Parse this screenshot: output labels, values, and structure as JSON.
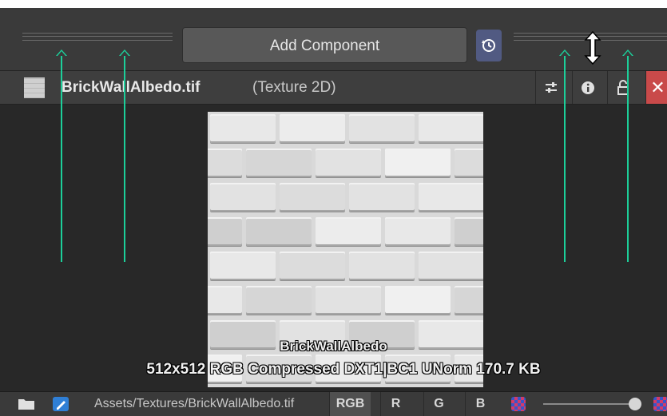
{
  "toolbar": {
    "add_component_label": "Add Component",
    "history_icon": "history-icon"
  },
  "header": {
    "asset_name": "BrickWallAlbedo.tif",
    "asset_type": "(Texture 2D)",
    "buttons": [
      "settings-sliders-icon",
      "info-icon",
      "lock-icon",
      "close-icon"
    ]
  },
  "preview": {
    "name": "BrickWallAlbedo",
    "description": "512x512  RGB Compressed DXT1|BC1 UNorm   170.7 KB"
  },
  "bottombar": {
    "path": "Assets/Textures/BrickWallAlbedo.tif",
    "channels": [
      "RGB",
      "R",
      "G",
      "B"
    ],
    "active_channel": "RGB"
  },
  "colors": {
    "panel_bg": "#282828",
    "toolbar_bg": "#3a3a3a",
    "history_button": "#515a82",
    "close_button": "#c94a4a",
    "annotation_arrow": "#1ccf9a"
  }
}
